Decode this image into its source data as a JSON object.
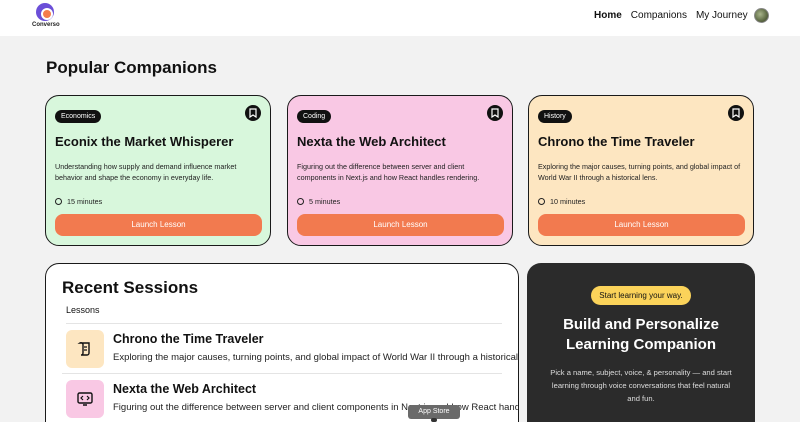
{
  "nav": {
    "logo_text": "Converso",
    "links": [
      {
        "label": "Home",
        "active": true
      },
      {
        "label": "Companions",
        "active": false
      },
      {
        "label": "My Journey",
        "active": false
      }
    ]
  },
  "popular": {
    "title": "Popular Companions",
    "cards": [
      {
        "subject": "Economics",
        "name": "Econix the Market Whisperer",
        "description": "Understanding how supply and demand influence market behavior and shape the economy in everyday life.",
        "duration": "15 minutes",
        "button": "Launch Lesson",
        "color": "#d8f7dc"
      },
      {
        "subject": "Coding",
        "name": "Nexta the Web Architect",
        "description": "Figuring out the difference between server and client components in Next.js and how React handles rendering.",
        "duration": "5 minutes",
        "button": "Launch Lesson",
        "color": "#f9c8e4"
      },
      {
        "subject": "History",
        "name": "Chrono the Time Traveler",
        "description": "Exploring the major causes, turning points, and global impact of World War II through a historical lens.",
        "duration": "10 minutes",
        "button": "Launch Lesson",
        "color": "#fde6c1"
      }
    ]
  },
  "recent": {
    "title": "Recent Sessions",
    "column_header": "Lessons",
    "sessions": [
      {
        "name": "Chrono the Time Traveler",
        "description": "Exploring the major causes, turning points, and global impact of World War II through a historical lens.",
        "icon": "scroll-icon"
      },
      {
        "name": "Nexta the Web Architect",
        "description": "Figuring out the difference between server and client components in Next.js and how React handles rendering.",
        "icon": "code-icon"
      }
    ]
  },
  "cta": {
    "badge": "Start learning your way.",
    "title": "Build and Personalize Learning Companion",
    "description": "Pick a name, subject, voice, & personality — and start learning through voice conversations that feel natural and fun."
  },
  "overlay": {
    "app_store": "App Store"
  },
  "colors": {
    "accent": "#f27a4f",
    "cta_bg": "#2b2b2b",
    "cta_badge": "#fbd35a"
  }
}
